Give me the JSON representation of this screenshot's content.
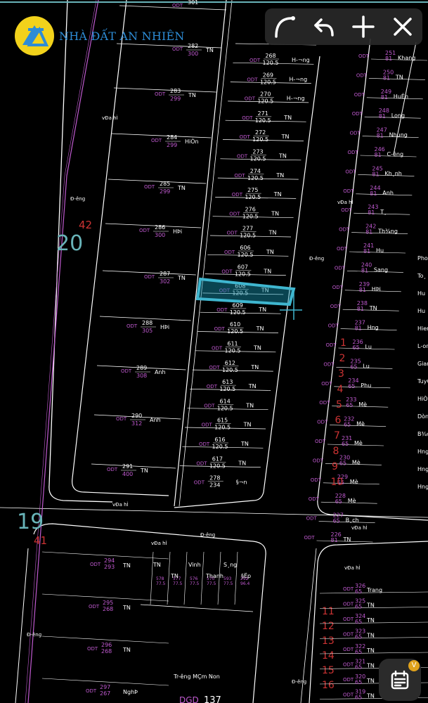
{
  "brand": {
    "name": "NHÀ ĐẤT AN NHIÊN"
  },
  "toolbar": {
    "icons": [
      "curve-tool-icon",
      "undo-icon",
      "add-icon",
      "close-icon"
    ]
  },
  "fab": {
    "badge": "V",
    "icon": "calendar-icon"
  },
  "map": {
    "colors": {
      "boundary": "#ffffff",
      "road_edge": "#e8e8e8",
      "purple": "#c05ad0",
      "red": "#cc3333",
      "cyan": "#68b3b8",
      "highlight": "#3fb6cf"
    },
    "sheet_labels": [
      {
        "text": "20"
      },
      {
        "text": "42"
      },
      {
        "text": "19"
      },
      {
        "text": "41"
      }
    ],
    "road_labels": [
      "vĐa hÌ",
      "Đ-êng",
      "vĐa hÌ",
      "Đ-êng",
      "vĐa hÌ",
      "vĐa hÌ",
      "Đ-êng",
      "vĐa hÌ",
      "vĐa hÌ",
      "Đ-êng",
      "Đ-êng"
    ],
    "left_parcels": [
      {
        "num": "301",
        "area": "",
        "owner": ""
      },
      {
        "num": "282",
        "area": "300",
        "owner": "TN"
      },
      {
        "num": "283",
        "area": "299",
        "owner": "TN"
      },
      {
        "num": "284",
        "area": "299",
        "owner": "HiÒn"
      },
      {
        "num": "285",
        "area": "299",
        "owner": "TN"
      },
      {
        "num": "286",
        "area": "300",
        "owner": "HÞi"
      },
      {
        "num": "287",
        "area": "302",
        "owner": "TN"
      },
      {
        "num": "288",
        "area": "305",
        "owner": "HÞi"
      },
      {
        "num": "289",
        "area": "308",
        "owner": "Anh"
      },
      {
        "num": "290",
        "area": "312",
        "owner": "Anh"
      },
      {
        "num": "291",
        "area": "400",
        "owner": "TN"
      }
    ],
    "middle_parcels": [
      {
        "num": "268",
        "area": "120.5",
        "owner": "H-¬ng"
      },
      {
        "num": "269",
        "area": "120.5",
        "owner": "H-¬ng"
      },
      {
        "num": "270",
        "area": "120.5",
        "owner": "H-¬ng"
      },
      {
        "num": "271",
        "area": "120.5",
        "owner": "TN"
      },
      {
        "num": "272",
        "area": "120.5",
        "owner": "TN"
      },
      {
        "num": "273",
        "area": "120.5",
        "owner": "TN"
      },
      {
        "num": "274",
        "area": "120.5",
        "owner": "TN"
      },
      {
        "num": "275",
        "area": "120.5",
        "owner": "TN"
      },
      {
        "num": "276",
        "area": "120.5",
        "owner": "TN"
      },
      {
        "num": "277",
        "area": "120.5",
        "owner": "TN"
      },
      {
        "num": "606",
        "area": "120.5",
        "owner": "TN"
      },
      {
        "num": "607",
        "area": "120.5",
        "owner": "TN"
      },
      {
        "num": "608",
        "area": "120.5",
        "owner": "TN"
      },
      {
        "num": "609",
        "area": "120.5",
        "owner": "TN"
      },
      {
        "num": "610",
        "area": "120.5",
        "owner": "TN"
      },
      {
        "num": "611",
        "area": "120.5",
        "owner": "TN"
      },
      {
        "num": "612",
        "area": "120.5",
        "owner": "TN"
      },
      {
        "num": "613",
        "area": "120.5",
        "owner": "TN"
      },
      {
        "num": "614",
        "area": "120.5",
        "owner": "TN"
      },
      {
        "num": "615",
        "area": "120.5",
        "owner": "TN"
      },
      {
        "num": "616",
        "area": "120.5",
        "owner": "TN"
      },
      {
        "num": "617",
        "area": "120.5",
        "owner": "TN"
      },
      {
        "num": "278",
        "area": "234",
        "owner": "§¬n"
      }
    ],
    "selected_parcel": "608",
    "right_parcels": [
      {
        "num": "251",
        "area": "81",
        "owner": "Khang"
      },
      {
        "num": "250",
        "area": "81",
        "owner": "TN"
      },
      {
        "num": "249",
        "area": "81",
        "owner": "HuÊn"
      },
      {
        "num": "248",
        "area": "81",
        "owner": "Long"
      },
      {
        "num": "247",
        "area": "81",
        "owner": "Nhung"
      },
      {
        "num": "246",
        "area": "81",
        "owner": "C-êng"
      },
      {
        "num": "245",
        "area": "81",
        "owner": "Kh¸nh"
      },
      {
        "num": "244",
        "area": "81",
        "owner": "Anh"
      },
      {
        "num": "243",
        "area": "81",
        "owner": "T¸"
      },
      {
        "num": "242",
        "area": "81",
        "owner": "Th¾ng"
      },
      {
        "num": "241",
        "area": "81",
        "owner": "Hu"
      },
      {
        "num": "240",
        "area": "81",
        "owner": "Sang"
      },
      {
        "num": "239",
        "area": "81",
        "owner": "HÞi"
      },
      {
        "num": "238",
        "area": "81",
        "owner": "TN"
      },
      {
        "num": "237",
        "area": "81",
        "owner": "H­ng"
      },
      {
        "num": "236",
        "area": "65",
        "owner": "Lu"
      },
      {
        "num": "235",
        "area": "65",
        "owner": "Lu"
      },
      {
        "num": "234",
        "area": "65",
        "owner": "Phu"
      },
      {
        "num": "233",
        "area": "65",
        "owner": "Mè"
      },
      {
        "num": "232",
        "area": "65",
        "owner": "Mè"
      },
      {
        "num": "231",
        "area": "65",
        "owner": "Mè"
      },
      {
        "num": "230",
        "area": "65",
        "owner": "Mè"
      },
      {
        "num": "229",
        "area": "65",
        "owner": "Mè"
      },
      {
        "num": "228",
        "area": "65",
        "owner": "Mè"
      },
      {
        "num": "227",
        "area": "65",
        "owner": "B¸ch"
      },
      {
        "num": "226",
        "area": "81",
        "owner": "TN"
      }
    ],
    "red_numbers": [
      "1",
      "2",
      "3",
      "4",
      "5",
      "6",
      "7",
      "8",
      "9",
      "10",
      "11",
      "12",
      "13",
      "14",
      "15",
      "16"
    ],
    "far_right_labels": [
      "Pho",
      "To¸",
      "Hu",
      "Hu",
      "Hien",
      "L-ong",
      "Giang",
      "TuyÕt",
      "HiÒu",
      "Dòng",
      "B¾c",
      "H­ng",
      "H­ng",
      "H­ng"
    ],
    "bottom_parcels": [
      {
        "num": "294",
        "area": "293",
        "owner": "TN"
      },
      {
        "num": "295",
        "area": "268",
        "owner": "TN"
      },
      {
        "num": "296",
        "area": "268",
        "owner": "TN"
      },
      {
        "num": "297",
        "area": "267",
        "owner": "NghÞ"
      },
      {
        "num": "578",
        "area": "77.5",
        "owner": ""
      },
      {
        "num": "577",
        "area": "77.5",
        "owner": ""
      },
      {
        "num": "576",
        "area": "77.5",
        "owner": ""
      },
      {
        "num": "570",
        "area": "77.5",
        "owner": ""
      },
      {
        "num": "593",
        "area": "77.5",
        "owner": ""
      },
      {
        "num": "292",
        "area": "96.4",
        "owner": ""
      }
    ],
    "bottom_owners": [
      "TN",
      "TN",
      "Vinh",
      "Thanh",
      "S¸ng",
      "§Ëp"
    ],
    "bottom_right_parcels": [
      {
        "num": "326",
        "area": "65",
        "owner": "Trang"
      },
      {
        "num": "325",
        "area": "65",
        "owner": "TN"
      },
      {
        "num": "324",
        "area": "65",
        "owner": "TN"
      },
      {
        "num": "323",
        "area": "65",
        "owner": "TN"
      },
      {
        "num": "322",
        "area": "65",
        "owner": "TN"
      },
      {
        "num": "321",
        "area": "65",
        "owner": "TN"
      },
      {
        "num": "320",
        "area": "65",
        "owner": "TN"
      },
      {
        "num": "319",
        "area": "65",
        "owner": "TN"
      }
    ],
    "school_label": "Tr-êng MÇm Non",
    "school_code": "DGD",
    "school_num": "137"
  }
}
